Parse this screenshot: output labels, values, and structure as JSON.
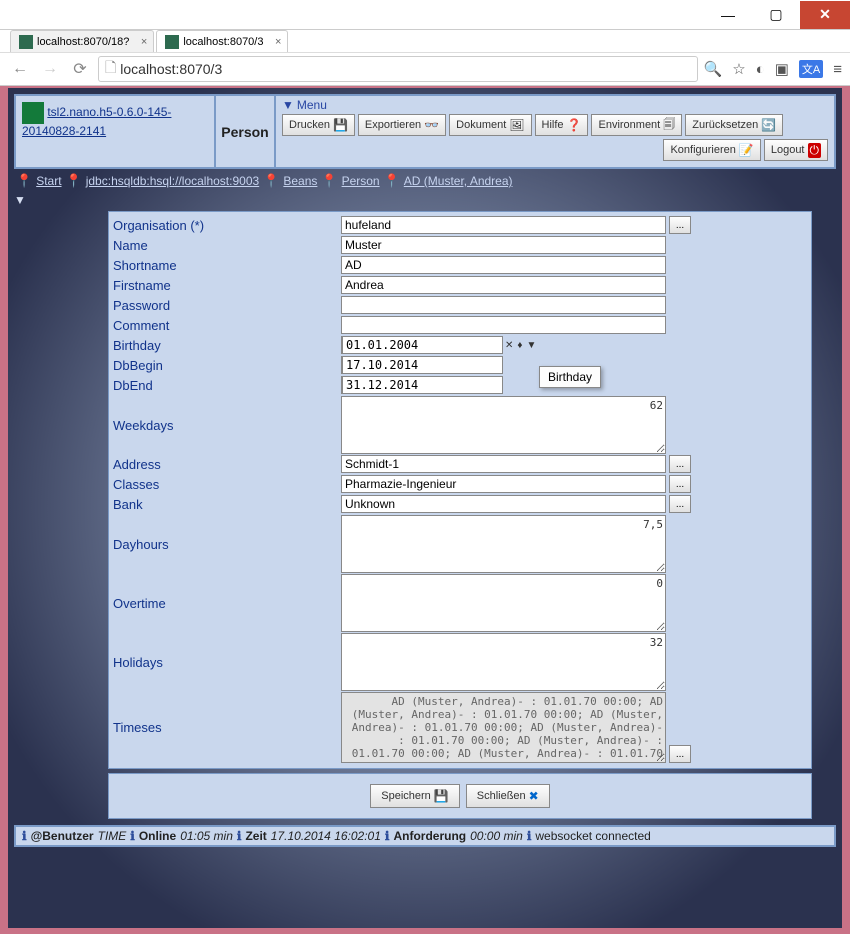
{
  "tabs": [
    {
      "label": "localhost:8070/18?",
      "active": false
    },
    {
      "label": "localhost:8070/3",
      "active": true
    }
  ],
  "address": "localhost:8070/3",
  "brand": {
    "link": "tsl2.nano.h5-0.6.0-145-20140828-2141"
  },
  "page": {
    "title": "Person",
    "menu_label": "Menu"
  },
  "toolbar": {
    "drucken": "Drucken",
    "exportieren": "Exportieren",
    "dokument": "Dokument",
    "hilfe": "Hilfe",
    "environment": "Environment",
    "zuruecksetzen": "Zurücksetzen",
    "konfigurieren": "Konfigurieren",
    "logout": "Logout"
  },
  "breadcrumb": {
    "start": "Start",
    "jdbc": "jdbc:hsqldb:hsql://localhost:9003",
    "beans": "Beans",
    "person": "Person",
    "ad": "AD (Muster, Andrea)"
  },
  "form": {
    "organisation_lbl": "Organisation (*)",
    "organisation": "hufeland",
    "name_lbl": "Name",
    "name": "Muster",
    "shortname_lbl": "Shortname",
    "shortname": "AD",
    "firstname_lbl": "Firstname",
    "firstname": "Andrea",
    "password_lbl": "Password",
    "password": "",
    "comment_lbl": "Comment",
    "comment": "",
    "birthday_lbl": "Birthday",
    "birthday": "01.01.2004",
    "dbbegin_lbl": "DbBegin",
    "dbbegin": "17.10.2014",
    "dbend_lbl": "DbEnd",
    "dbend": "31.12.2014",
    "weekdays_lbl": "Weekdays",
    "weekdays": "62",
    "address_lbl": "Address",
    "address": "Schmidt-1",
    "classes_lbl": "Classes",
    "classes": "Pharmazie-Ingenieur",
    "bank_lbl": "Bank",
    "bank": "Unknown",
    "dayhours_lbl": "Dayhours",
    "dayhours": "7,5",
    "overtime_lbl": "Overtime",
    "overtime": "0",
    "holidays_lbl": "Holidays",
    "holidays": "32",
    "timeses_lbl": "Timeses",
    "timeses": "   AD (Muster, Andrea)- : 01.01.70 00:00; AD\n(Muster, Andrea)- : 01.01.70 00:00; AD (Muster,\nAndrea)- : 01.01.70 00:00; AD (Muster, Andrea)-\n     : 01.01.70 00:00; AD (Muster, Andrea)- :\n01.01.70 00:00; AD (Muster, Andrea)- : 01.01.70"
  },
  "tooltip": "Birthday",
  "bottom": {
    "speichern": "Speichern",
    "schliessen": "Schließen"
  },
  "status": {
    "benutzer_lbl": "@Benutzer",
    "benutzer": "TIME",
    "online_lbl": "Online",
    "online": "01:05 min",
    "zeit_lbl": "Zeit",
    "zeit": "17.10.2014 16:02:01",
    "anforderung_lbl": "Anforderung",
    "anforderung": "00:00 min",
    "ws": "websocket connected"
  }
}
